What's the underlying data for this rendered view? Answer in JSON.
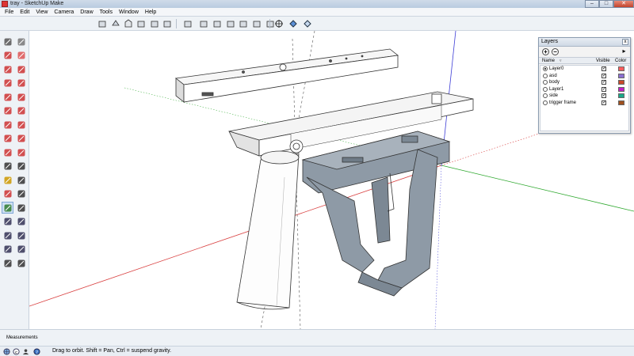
{
  "window": {
    "title": "tray - SketchUp Make",
    "minimize": "–",
    "maximize": "□",
    "close": "✕"
  },
  "menu": [
    "File",
    "Edit",
    "View",
    "Camera",
    "Draw",
    "Tools",
    "Window",
    "Help"
  ],
  "toolbar": {
    "icons": [
      "iso-view-icon",
      "top-view-icon",
      "front-view-icon",
      "right-view-icon",
      "back-view-icon",
      "left-view-icon",
      "xray-icon",
      "back-edges-icon",
      "wireframe-icon",
      "hidden-line-icon",
      "shaded-icon",
      "shaded-textures-icon",
      "monochrome-icon",
      "add-location-icon",
      "get-models-icon",
      "share-model-icon"
    ]
  },
  "left_tools": [
    "select-icon",
    "make-component-icon",
    "paint-bucket-icon",
    "eraser-icon",
    "line-icon",
    "freehand-icon",
    "rectangle-icon",
    "rotated-rectangle-icon",
    "circle-icon",
    "polygon-icon",
    "arc-icon",
    "pie-icon",
    "move-icon",
    "push-pull-icon",
    "rotate-icon",
    "follow-me-icon",
    "scale-icon",
    "offset-icon",
    "tape-measure-icon",
    "dimension-icon",
    "protractor-icon",
    "text-icon",
    "axes-icon",
    "3d-text-icon",
    "orbit-icon",
    "pan-icon",
    "zoom-icon",
    "zoom-window-icon",
    "zoom-extents-icon",
    "previous-view-icon",
    "position-camera-icon",
    "look-around-icon",
    "walk-icon",
    "section-plane-icon"
  ],
  "layers_panel": {
    "title": "Layers",
    "close": "x",
    "add_label": "+",
    "remove_label": "−",
    "details_label": "▸",
    "col_name": "Name",
    "col_visible": "Visible",
    "col_color": "Color",
    "layers": [
      {
        "name": "Layer0",
        "active": true,
        "visible": true,
        "color": "#ff5d5d"
      },
      {
        "name": "asd",
        "active": false,
        "visible": true,
        "color": "#8a6fd1"
      },
      {
        "name": "body",
        "active": false,
        "visible": true,
        "color": "#c9492a"
      },
      {
        "name": "Layer1",
        "active": false,
        "visible": true,
        "color": "#c21fc8"
      },
      {
        "name": "side",
        "active": false,
        "visible": true,
        "color": "#1aa889"
      },
      {
        "name": "trigger frame",
        "active": false,
        "visible": true,
        "color": "#a0501e"
      }
    ]
  },
  "measurements": {
    "label": "Measurements"
  },
  "status": {
    "text": "Drag to orbit.  Shift = Pan, Ctrl = suspend gravity."
  },
  "colors": {
    "axis_red": "#d94040",
    "axis_green": "#2ea82e",
    "axis_blue": "#3d3dd6",
    "model_face": "#f3f3f3",
    "frame_gray": "#8e9aa6"
  }
}
